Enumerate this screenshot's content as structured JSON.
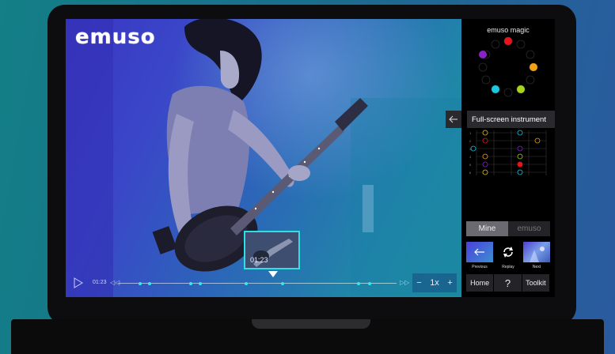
{
  "video": {
    "logo": "emuso",
    "preview_time": "01:23",
    "current_time": "01:23",
    "speed": "1x",
    "speed_minus": "−",
    "speed_plus": "+",
    "play_icon": "play-icon",
    "skip_back": "◁◁",
    "skip_forward": "▷▷"
  },
  "panel": {
    "magic_title": "emuso magic",
    "instrument_title": "Full-screen instrument",
    "tabs": {
      "mine": "Mine",
      "emuso": "emuso"
    },
    "nav": [
      {
        "label": "Previous",
        "icon": "arrow-left-icon"
      },
      {
        "label": "Replay",
        "icon": "replay-icon"
      },
      {
        "label": "Next",
        "icon": "concert-thumbnail"
      }
    ],
    "bottom": {
      "home": "Home",
      "help": "?",
      "toolkit": "Toolkit"
    },
    "fret_numbers": [
      "1",
      "2",
      "3",
      "4",
      "5",
      "6"
    ]
  },
  "colors": {
    "accent": "#2de0e6",
    "wheel_red": "#e8141c",
    "wheel_orange": "#f2a116",
    "wheel_green": "#a6d416",
    "wheel_cyan": "#19c9e0",
    "wheel_purple": "#8a22c8"
  }
}
